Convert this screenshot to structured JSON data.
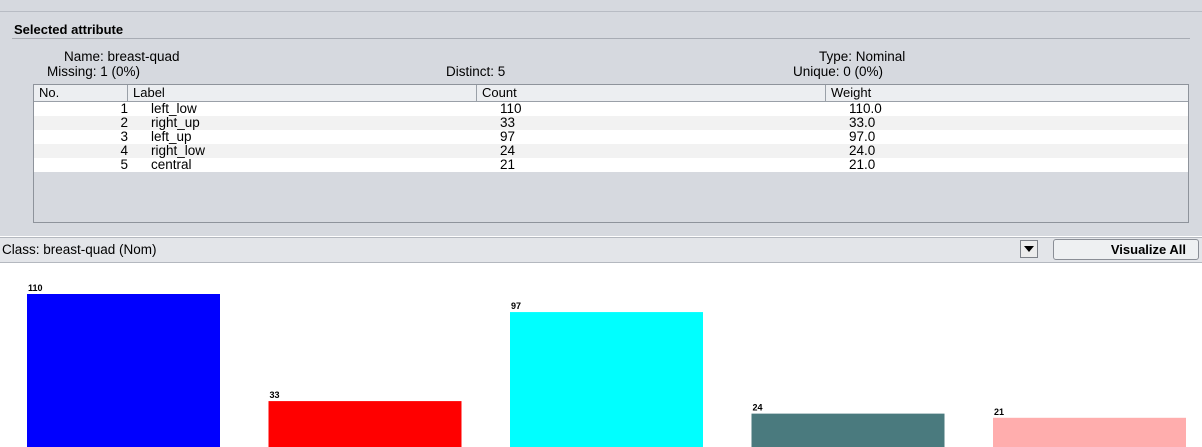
{
  "panel": {
    "title": "Selected attribute",
    "name_text": "Name: breast-quad",
    "missing_text": "Missing: 1 (0%)",
    "distinct_text": "Distinct: 5",
    "type_text": "Type: Nominal",
    "unique_text": "Unique: 0 (0%)"
  },
  "table": {
    "headers": [
      "No.",
      "Label",
      "Count",
      "Weight"
    ],
    "rows": [
      {
        "no": "1",
        "label": "left_low",
        "count": "110",
        "weight": "110.0"
      },
      {
        "no": "2",
        "label": "right_up",
        "count": "33",
        "weight": "33.0"
      },
      {
        "no": "3",
        "label": "left_up",
        "count": "97",
        "weight": "97.0"
      },
      {
        "no": "4",
        "label": "right_low",
        "count": "24",
        "weight": "24.0"
      },
      {
        "no": "5",
        "label": "central",
        "count": "21",
        "weight": "21.0"
      }
    ]
  },
  "class_bar": {
    "selected": "Class: breast-quad (Nom)",
    "visualize_label": "Visualize All",
    "dropdown_icon": "chevron-down-icon"
  },
  "chart_data": {
    "type": "bar",
    "categories": [
      "left_low",
      "right_up",
      "left_up",
      "right_low",
      "central"
    ],
    "values": [
      110,
      33,
      97,
      24,
      21
    ],
    "data_labels": [
      "110",
      "33",
      "97",
      "24",
      "21"
    ],
    "colors": [
      "#0000ff",
      "#ff0000",
      "#00ffff",
      "#4a7a7e",
      "#ffadad"
    ],
    "ylim": [
      0,
      110
    ],
    "grid": false
  }
}
